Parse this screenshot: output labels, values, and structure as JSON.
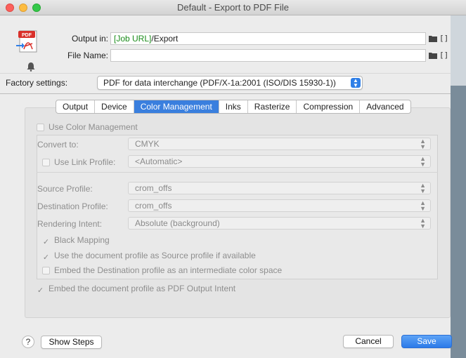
{
  "window": {
    "title": "Default - Export to PDF File"
  },
  "output": {
    "output_in_label": "Output in:",
    "output_in_token": "[Job URL]",
    "output_in_path": "/Export",
    "file_name_label": "File Name:",
    "file_name_value": "",
    "bracket_glyph": "[]",
    "pdf_badge": "PDF"
  },
  "factory": {
    "label": "Factory settings:",
    "value": "PDF for data interchange (PDF/X-1a:2001 (ISO/DIS 15930-1))"
  },
  "tabs": [
    {
      "label": "Output"
    },
    {
      "label": "Device"
    },
    {
      "label": "Color Management",
      "active": true
    },
    {
      "label": "Inks"
    },
    {
      "label": "Rasterize"
    },
    {
      "label": "Compression"
    },
    {
      "label": "Advanced"
    }
  ],
  "color_management": {
    "use_color_management": {
      "label": "Use Color Management",
      "checked": false
    },
    "convert_to": {
      "label": "Convert to:",
      "value": "CMYK"
    },
    "use_link_profile": {
      "label": "Use Link Profile:",
      "value": "<Automatic>",
      "checked": false
    },
    "source_profile": {
      "label": "Source Profile:",
      "value": "crom_offs"
    },
    "destination_profile": {
      "label": "Destination Profile:",
      "value": "crom_offs"
    },
    "rendering_intent": {
      "label": "Rendering Intent:",
      "value": "Absolute (background)"
    },
    "black_mapping": {
      "label": "Black Mapping",
      "checked": true
    },
    "use_document_profile": {
      "label": "Use the document profile as Source profile if available",
      "checked": true
    },
    "embed_destination": {
      "label": "Embed the Destination profile as an intermediate color space",
      "checked": false
    },
    "embed_output_intent": {
      "label": "Embed the document profile as PDF Output Intent",
      "checked": true
    }
  },
  "buttons": {
    "help": "?",
    "show_steps": "Show Steps",
    "cancel": "Cancel",
    "save": "Save"
  },
  "glyphs": {
    "check": "✓",
    "stepper_up": "▲",
    "stepper_down": "▼"
  },
  "colors": {
    "accent": "#3a7fde",
    "green_token": "#1a8c1a",
    "close": "#fc605c",
    "minimize": "#fdbc40",
    "maximize": "#34c84a"
  }
}
